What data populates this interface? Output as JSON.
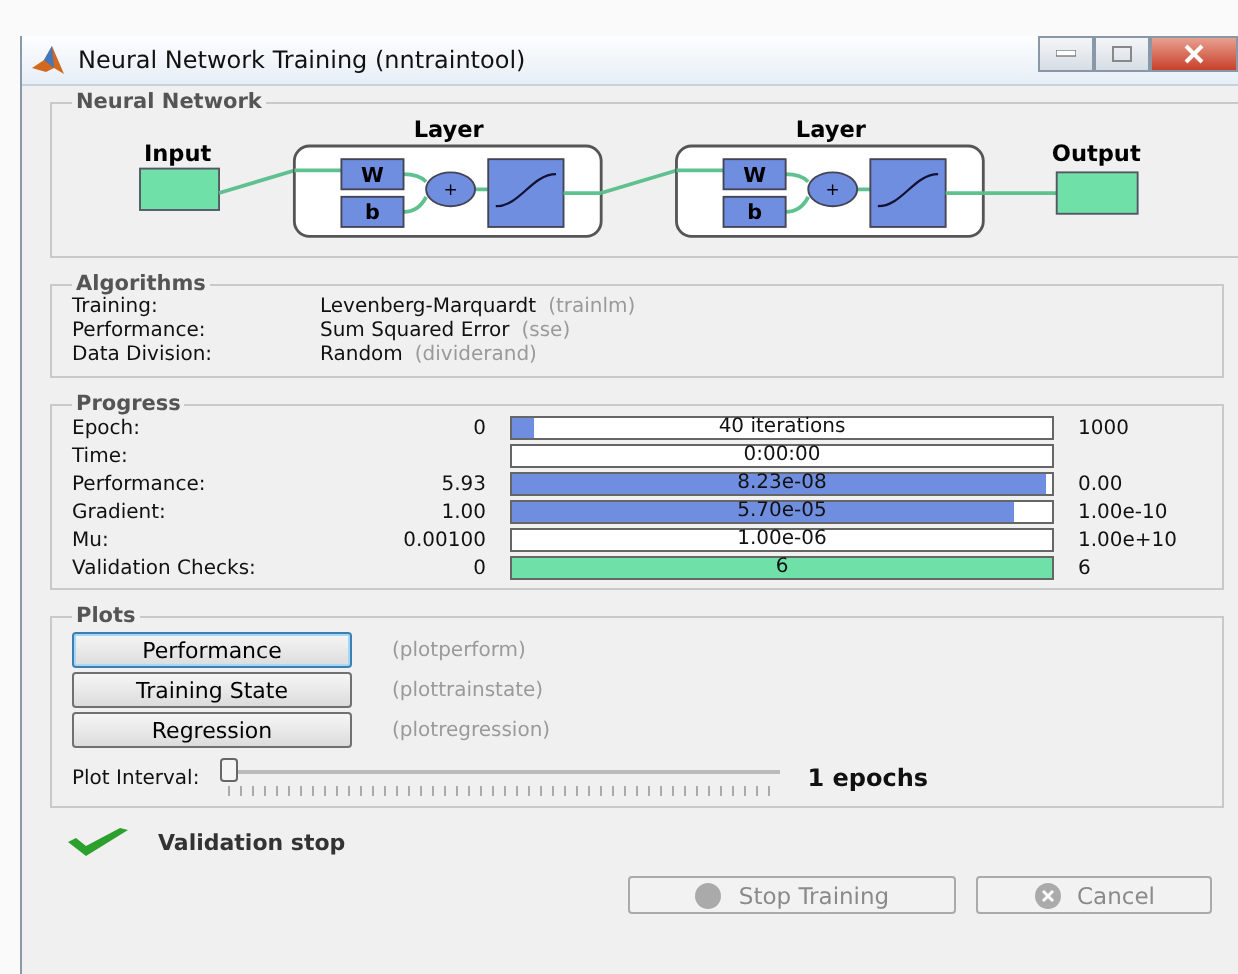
{
  "window": {
    "title": "Neural Network Training (nntraintool)"
  },
  "network": {
    "title": "Neural Network",
    "input": "Input",
    "output": "Output",
    "layers": [
      {
        "label": "Layer",
        "weight": "W",
        "bias": "b",
        "sum": "+"
      },
      {
        "label": "Layer",
        "weight": "W",
        "bias": "b",
        "sum": "+"
      }
    ]
  },
  "algorithms": {
    "title": "Algorithms",
    "rows": [
      {
        "label": "Training:",
        "value": "Levenberg-Marquardt",
        "function": "(trainlm)"
      },
      {
        "label": "Performance:",
        "value": "Sum Squared Error",
        "function": "(sse)"
      },
      {
        "label": "Data Division:",
        "value": "Random",
        "function": "(dividerand)"
      }
    ]
  },
  "progress": {
    "title": "Progress",
    "rows": [
      {
        "label": "Epoch:",
        "start": "0",
        "reading": "40 iterations",
        "end": "1000",
        "level": 0.04,
        "color": "#6f8ee0"
      },
      {
        "label": "Time:",
        "reading": "0:00:00"
      },
      {
        "label": "Performance:",
        "start": "5.93",
        "reading": "8.23e-08",
        "end": "0.00",
        "level": 0.99,
        "color": "#6f8ee0"
      },
      {
        "label": "Gradient:",
        "start": "1.00",
        "reading": "5.70e-05",
        "end": "1.00e-10",
        "level": 0.93,
        "color": "#6f8ee0"
      },
      {
        "label": "Mu:",
        "start": "0.00100",
        "reading": "1.00e-06",
        "end": "1.00e+10"
      },
      {
        "label": "Validation Checks:",
        "start": "0",
        "reading": "6",
        "end": "6",
        "level": 1,
        "color": "#6fe0a8"
      }
    ]
  },
  "plots": {
    "title": "Plots",
    "buttons": [
      {
        "label": "Performance",
        "function": "(plotperform)",
        "focused": true
      },
      {
        "label": "Training State",
        "function": "(plottrainstate)",
        "focused": false
      },
      {
        "label": "Regression",
        "function": "(plotregression)",
        "focused": false
      }
    ],
    "interval": {
      "label": "Plot Interval:",
      "level": 0,
      "reading": "1 epochs"
    }
  },
  "status": {
    "text": "Validation stop"
  },
  "buttons": [
    {
      "label": "Stop Training",
      "kind": "stop",
      "disabled": true
    },
    {
      "label": "Cancel",
      "kind": "cancel",
      "disabled": true
    }
  ]
}
